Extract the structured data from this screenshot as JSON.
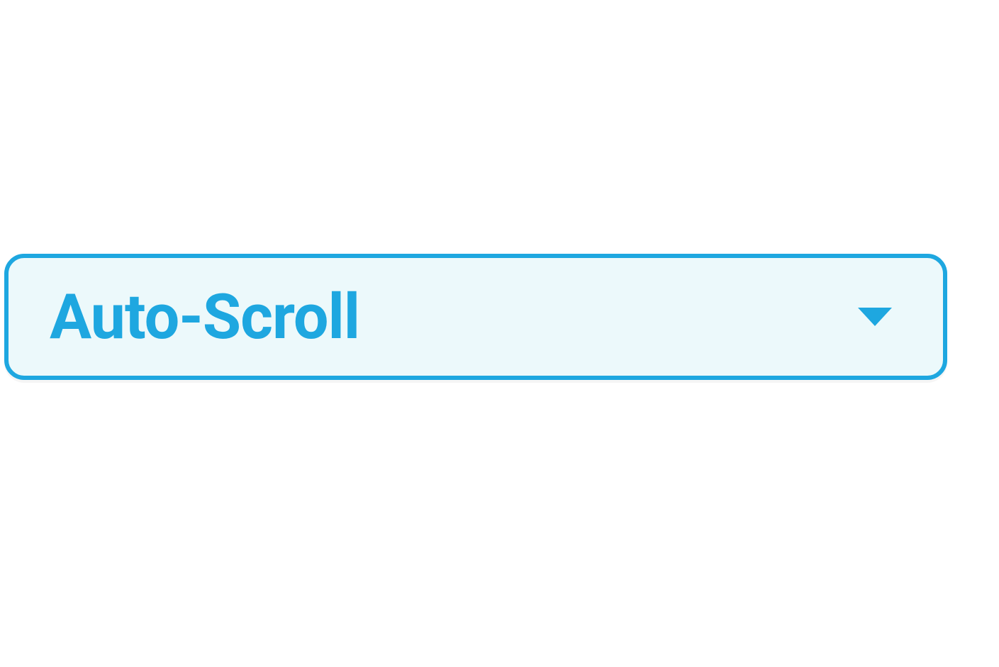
{
  "dropdown": {
    "label": "Auto-Scroll"
  }
}
